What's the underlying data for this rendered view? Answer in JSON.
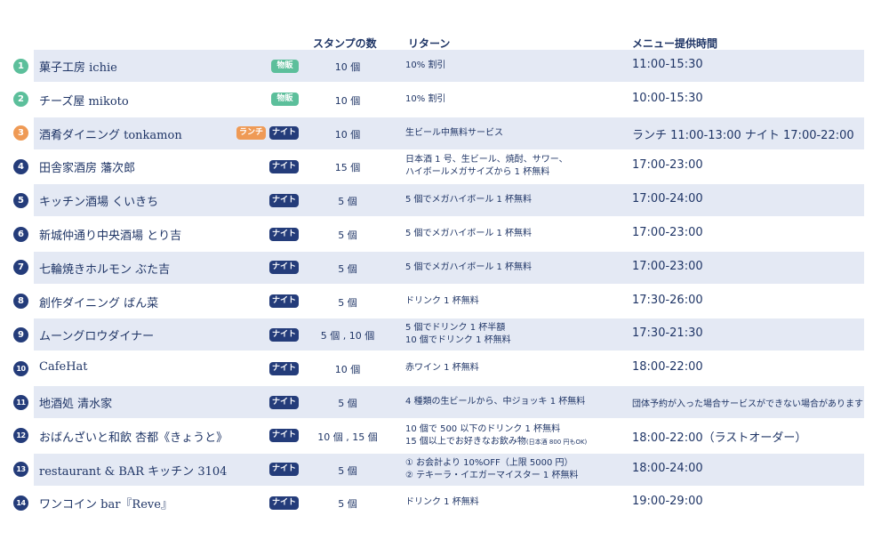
{
  "headers": {
    "stamps": "スタンプの数",
    "return": "リターン",
    "menu_time": "メニュー提供時間"
  },
  "colors": {
    "navy": "#1f3566",
    "row_shade": "#e4e9f4",
    "badge_green": "#5cbf9b",
    "badge_night": "#243c7a",
    "badge_lunch": "#ef9a55"
  },
  "rows": [
    {
      "num": "1",
      "name": "菓子工房 ichie",
      "badges": [
        "物販"
      ],
      "stamps": "10 個",
      "return": [
        "10% 割引"
      ],
      "time": "11:00-15:30"
    },
    {
      "num": "2",
      "name": "チーズ屋 mikoto",
      "badges": [
        "物販"
      ],
      "stamps": "10 個",
      "return": [
        "10% 割引"
      ],
      "time": "10:00-15:30"
    },
    {
      "num": "3",
      "name": "酒肴ダイニング tonkamon",
      "badges": [
        "ランチ",
        "ナイト"
      ],
      "stamps": "10 個",
      "return": [
        "生ビール中無料サービス"
      ],
      "time": "ランチ 11:00-13:00  ナイト 17:00-22:00"
    },
    {
      "num": "4",
      "name": "田舎家酒房 藩次郎",
      "badges": [
        "ナイト"
      ],
      "stamps": "15 個",
      "return": [
        "日本酒 1 号、生ビール、焼酎、サワー、",
        "ハイボールメガサイズから 1 杯無料"
      ],
      "time": "17:00-23:00"
    },
    {
      "num": "5",
      "name": "キッチン酒場 くいきち",
      "badges": [
        "ナイト"
      ],
      "stamps": "5 個",
      "return": [
        "5 個でメガハイボール 1 杯無料"
      ],
      "time": "17:00-24:00"
    },
    {
      "num": "6",
      "name": "新城仲通り中央酒場 とり吉",
      "badges": [
        "ナイト"
      ],
      "stamps": "5 個",
      "return": [
        "5 個でメガハイボール 1 杯無料"
      ],
      "time": "17:00-23:00"
    },
    {
      "num": "7",
      "name": "七輪焼きホルモン ぶた吉",
      "badges": [
        "ナイト"
      ],
      "stamps": "5 個",
      "return": [
        "5 個でメガハイボール 1 杯無料"
      ],
      "time": "17:00-23:00"
    },
    {
      "num": "8",
      "name": "創作ダイニング ばん菜",
      "badges": [
        "ナイト"
      ],
      "stamps": "5 個",
      "return": [
        "ドリンク 1 杯無料"
      ],
      "time": "17:30-26:00"
    },
    {
      "num": "9",
      "name": "ムーングロウダイナー",
      "badges": [
        "ナイト"
      ],
      "stamps": "5 個 , 10 個",
      "return": [
        "5 個でドリンク 1 杯半額",
        "10 個でドリンク 1 杯無料"
      ],
      "time": "17:30-21:30"
    },
    {
      "num": "10",
      "name": "CafeHat",
      "badges": [
        "ナイト"
      ],
      "stamps": "10 個",
      "return": [
        "赤ワイン 1 杯無料"
      ],
      "time": "18:00-22:00"
    },
    {
      "num": "11",
      "name": "地酒処 清水家",
      "badges": [
        "ナイト"
      ],
      "stamps": "5 個",
      "return": [
        "4 種類の生ビールから、中ジョッキ 1 杯無料"
      ],
      "time": "団体予約が入った場合サービスができない場合があります"
    },
    {
      "num": "12",
      "name": "おばんざいと和飲 杏都《きょうと》",
      "badges": [
        "ナイト"
      ],
      "stamps": "10 個 , 15 個",
      "return": [
        "10 個で 500 以下のドリンク 1 杯無料",
        "15 個以上でお好きなお飲み物"
      ],
      "return_note": "(日本酒 800 円もOK)",
      "time": "18:00-22:00（ラストオーダー）"
    },
    {
      "num": "13",
      "name": "restaurant & BAR キッチン 3104",
      "badges": [
        "ナイト"
      ],
      "stamps": "5 個",
      "return": [
        "① お会計より 10%OFF（上限 5000 円）",
        "② テキーラ・イエガーマイスター 1 杯無料"
      ],
      "time": "18:00-24:00"
    },
    {
      "num": "14",
      "name": "ワンコイン bar『Reve』",
      "badges": [
        "ナイト"
      ],
      "stamps": "5 個",
      "return": [
        "ドリンク 1 杯無料"
      ],
      "time": "19:00-29:00"
    }
  ]
}
